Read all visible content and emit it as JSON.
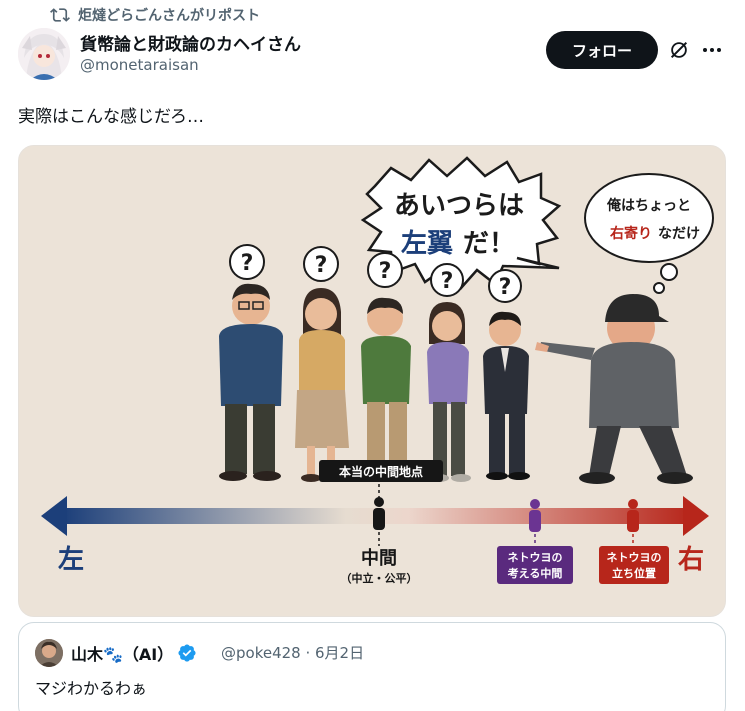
{
  "repost": {
    "label": "炬燵どらごんさんがリポスト"
  },
  "author": {
    "display_name": "貨幣論と財政論のカヘイさん",
    "handle": "@monetaraisan"
  },
  "follow_button": "フォロー",
  "tweet_text": "実際はこんな感じだろ…",
  "image": {
    "speech_bubble_line1": "あいつらは",
    "speech_bubble_left": "左翼",
    "speech_bubble_rest": "だ！",
    "thought_line1": "俺はちょっと",
    "thought_right": "右寄り",
    "thought_rest": "なだけ",
    "question_mark": "?",
    "midpoint_tag": "本当の中間地点",
    "left_label": "左",
    "right_label": "右",
    "center_label": "中間",
    "center_sub": "（中立・公平）",
    "netuyo_mid_line1": "ネトウヨの",
    "netuyo_mid_line2": "考える中間",
    "netuyo_pos_line1": "ネトウヨの",
    "netuyo_pos_line2": "立ち位置",
    "colors": {
      "left": "#1c3f7a",
      "right": "#b7261b",
      "purple": "#5a2a7e",
      "background": "#ece3d8"
    }
  },
  "quote": {
    "display_name": "山木🐾（AI）",
    "handle_date": "@poke428 · 6月2日",
    "text": "マジわかるわぁ"
  }
}
